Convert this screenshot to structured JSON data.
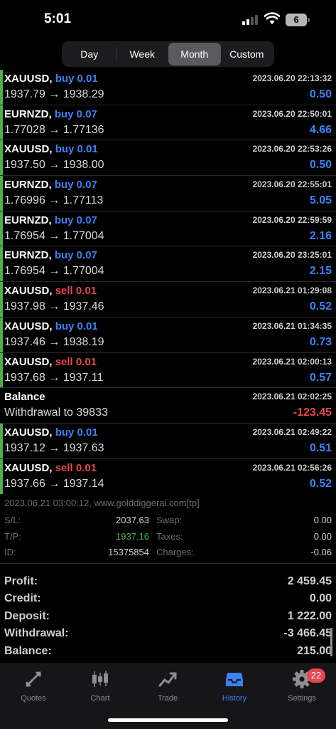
{
  "status_bar": {
    "time": "5:01",
    "battery": "6"
  },
  "period_tabs": [
    {
      "label": "Day",
      "active": false
    },
    {
      "label": "Week",
      "active": false
    },
    {
      "label": "Month",
      "active": true
    },
    {
      "label": "Custom",
      "active": false
    }
  ],
  "rows": [
    {
      "kind": "trade",
      "symbol": "XAUUSD,",
      "side": "buy",
      "side_text": "buy 0.01",
      "datetime": "2023.06.20 22:13:32",
      "prices": "1937.79 → 1938.29",
      "profit": "0.50",
      "profit_sign": "pos"
    },
    {
      "kind": "trade",
      "symbol": "EURNZD,",
      "side": "buy",
      "side_text": "buy 0.07",
      "datetime": "2023.06.20 22:50:01",
      "prices": "1.77028 → 1.77136",
      "profit": "4.66",
      "profit_sign": "pos"
    },
    {
      "kind": "trade",
      "symbol": "XAUUSD,",
      "side": "buy",
      "side_text": "buy 0.01",
      "datetime": "2023.06.20 22:53:26",
      "prices": "1937.50 → 1938.00",
      "profit": "0.50",
      "profit_sign": "pos"
    },
    {
      "kind": "trade",
      "symbol": "EURNZD,",
      "side": "buy",
      "side_text": "buy 0.07",
      "datetime": "2023.06.20 22:55:01",
      "prices": "1.76996 → 1.77113",
      "profit": "5.05",
      "profit_sign": "pos"
    },
    {
      "kind": "trade",
      "symbol": "EURNZD,",
      "side": "buy",
      "side_text": "buy 0.07",
      "datetime": "2023.06.20 22:59:59",
      "prices": "1.76954 → 1.77004",
      "profit": "2.16",
      "profit_sign": "pos"
    },
    {
      "kind": "trade",
      "symbol": "EURNZD,",
      "side": "buy",
      "side_text": "buy 0.07",
      "datetime": "2023.06.20 23:25:01",
      "prices": "1.76954 → 1.77004",
      "profit": "2.15",
      "profit_sign": "pos"
    },
    {
      "kind": "trade",
      "symbol": "XAUUSD,",
      "side": "sell",
      "side_text": "sell 0.01",
      "datetime": "2023.06.21 01:29:08",
      "prices": "1937.98 → 1937.46",
      "profit": "0.52",
      "profit_sign": "pos"
    },
    {
      "kind": "trade",
      "symbol": "XAUUSD,",
      "side": "buy",
      "side_text": "buy 0.01",
      "datetime": "2023.06.21 01:34:35",
      "prices": "1937.46 → 1938.19",
      "profit": "0.73",
      "profit_sign": "pos"
    },
    {
      "kind": "trade",
      "symbol": "XAUUSD,",
      "side": "sell",
      "side_text": "sell 0.01",
      "datetime": "2023.06.21 02:00:13",
      "prices": "1937.68 → 1937.11",
      "profit": "0.57",
      "profit_sign": "pos"
    },
    {
      "kind": "balance",
      "symbol": "Balance",
      "side": "",
      "side_text": "",
      "datetime": "2023.06.21 02:02:25",
      "prices": "Withdrawal to 39833",
      "profit": "-123.45",
      "profit_sign": "neg"
    },
    {
      "kind": "trade",
      "symbol": "XAUUSD,",
      "side": "buy",
      "side_text": "buy 0.01",
      "datetime": "2023.06.21 02:49:22",
      "prices": "1937.12 → 1937.63",
      "profit": "0.51",
      "profit_sign": "pos"
    },
    {
      "kind": "trade",
      "symbol": "XAUUSD,",
      "side": "sell",
      "side_text": "sell 0.01",
      "datetime": "2023.06.21 02:56:26",
      "prices": "1937.66 → 1937.14",
      "profit": "0.52",
      "profit_sign": "pos"
    }
  ],
  "details": {
    "comment": "2023.06.21 03:00:12, www.golddiggerai.com[tp]",
    "sl_label": "S/L:",
    "sl_value": "2037.63",
    "tp_label": "T/P:",
    "tp_value": "1937.16",
    "id_label": "ID:",
    "id_value": "15375854",
    "swap_label": "Swap:",
    "swap_value": "0.00",
    "taxes_label": "Taxes:",
    "taxes_value": "0.00",
    "charges_label": "Charges:",
    "charges_value": "-0.06"
  },
  "summary": [
    {
      "label": "Profit:",
      "value": "2 459.45"
    },
    {
      "label": "Credit:",
      "value": "0.00"
    },
    {
      "label": "Deposit:",
      "value": "1 222.00"
    },
    {
      "label": "Withdrawal:",
      "value": "-3 466.45"
    },
    {
      "label": "Balance:",
      "value": "215.00"
    }
  ],
  "tabbar": {
    "quotes": "Quotes",
    "chart": "Chart",
    "trade": "Trade",
    "history": "History",
    "settings": "Settings",
    "settings_badge": "22",
    "active_tab": "History",
    "active_color": "#3b82f6",
    "inactive_color": "#8e8e93"
  },
  "colors": {
    "buy": "#3b82f6",
    "sell": "#e5484d",
    "trade_marker": "#4caf50"
  }
}
